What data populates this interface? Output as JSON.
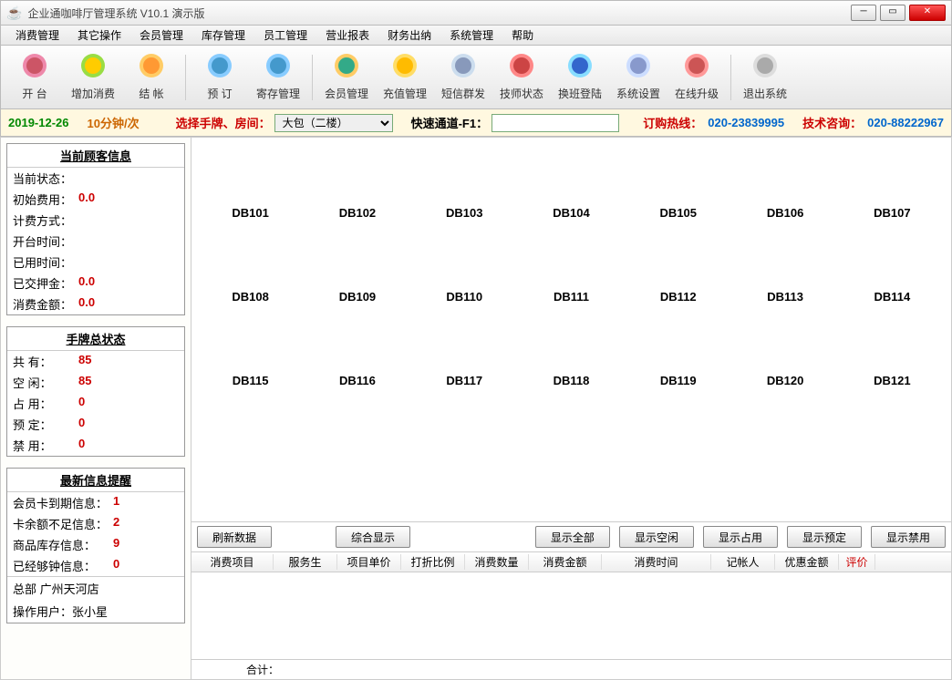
{
  "window": {
    "title": "企业通咖啡厅管理系统 V10.1 演示版"
  },
  "menu": [
    "消费管理",
    "其它操作",
    "会员管理",
    "库存管理",
    "员工管理",
    "营业报表",
    "财务出纳",
    "系统管理",
    "帮助"
  ],
  "toolbar": [
    {
      "id": "kaitai",
      "label": "开 台",
      "color1": "#e8a",
      "color2": "#c56"
    },
    {
      "id": "zengjia",
      "label": "增加消费",
      "color1": "#9d4",
      "color2": "#fc0"
    },
    {
      "id": "jiezhang",
      "label": "结 帐",
      "color1": "#fc6",
      "color2": "#f93"
    },
    {
      "id": "yuding",
      "label": "预 订",
      "color1": "#8cf",
      "color2": "#49c"
    },
    {
      "id": "jicun",
      "label": "寄存管理",
      "color1": "#8cf",
      "color2": "#49c"
    },
    {
      "id": "huiyuan",
      "label": "会员管理",
      "color1": "#fc6",
      "color2": "#3a8"
    },
    {
      "id": "chongzhi",
      "label": "充值管理",
      "color1": "#fd6",
      "color2": "#fb0"
    },
    {
      "id": "duanxin",
      "label": "短信群发",
      "color1": "#cde",
      "color2": "#89b"
    },
    {
      "id": "jishi",
      "label": "技师状态",
      "color1": "#f88",
      "color2": "#c44"
    },
    {
      "id": "huanban",
      "label": "换班登陆",
      "color1": "#8df",
      "color2": "#36c"
    },
    {
      "id": "xitong",
      "label": "系统设置",
      "color1": "#cdf",
      "color2": "#89c"
    },
    {
      "id": "zaixian",
      "label": "在线升级",
      "color1": "#f99",
      "color2": "#c55"
    },
    {
      "id": "tuichu",
      "label": "退出系统",
      "color1": "#ddd",
      "color2": "#aaa"
    }
  ],
  "filter": {
    "date": "2019-12-26",
    "rate": "10分钟/次",
    "select_room_label": "选择手牌、房间：",
    "room_select_value": "大包（二楼）",
    "fast_channel_label": "快速通道-F1：",
    "fast_channel_value": "",
    "hotline_label": "订购热线：",
    "hotline_num": "020-23839995",
    "tech_label": "技术咨询：",
    "tech_num": "020-88222967"
  },
  "guest_panel": {
    "title": "当前顾客信息",
    "rows": [
      {
        "k": "当前状态：",
        "v": ""
      },
      {
        "k": "初始费用：",
        "v": "0.0",
        "red": true
      },
      {
        "k": "计费方式：",
        "v": ""
      },
      {
        "k": "开台时间：",
        "v": ""
      },
      {
        "k": "已用时间：",
        "v": ""
      },
      {
        "k": "已交押金：",
        "v": "0.0",
        "red": true
      },
      {
        "k": "消费金额：",
        "v": "0.0",
        "red": true
      }
    ]
  },
  "status_panel": {
    "title": "手牌总状态",
    "rows": [
      {
        "k": "共    有：",
        "v": "85",
        "red": true
      },
      {
        "k": "空    闲：",
        "v": "85",
        "red": true
      },
      {
        "k": "占    用：",
        "v": "0",
        "red": true
      },
      {
        "k": "预    定：",
        "v": "0",
        "red": true
      },
      {
        "k": "禁    用：",
        "v": "0",
        "red": true
      }
    ]
  },
  "alert_panel": {
    "title": "最新信息提醒",
    "rows": [
      {
        "k": "会员卡到期信息：",
        "v": "1",
        "red": true
      },
      {
        "k": "卡余额不足信息：",
        "v": "2",
        "red": true
      },
      {
        "k": "商品库存信息：",
        "v": "9",
        "red": true
      },
      {
        "k": "已经够钟信息：",
        "v": "0",
        "red": true
      }
    ],
    "store_line1": "总部  广州天河店",
    "store_line2": "操作用户：张小星"
  },
  "rooms": [
    "DB101",
    "DB102",
    "DB103",
    "DB104",
    "DB105",
    "DB106",
    "DB107",
    "DB108",
    "DB109",
    "DB110",
    "DB111",
    "DB112",
    "DB113",
    "DB114",
    "DB115",
    "DB116",
    "DB117",
    "DB118",
    "DB119",
    "DB120",
    "DB121",
    "",
    "",
    "",
    "",
    "",
    "",
    ""
  ],
  "btnrow": {
    "refresh": "刷新数据",
    "comprehensive": "综合显示",
    "all": "显示全部",
    "idle": "显示空闲",
    "used": "显示占用",
    "reserved": "显示预定",
    "disabled": "显示禁用"
  },
  "table_headers": [
    "消费项目",
    "服务生",
    "项目单价",
    "打折比例",
    "消费数量",
    "消费金额",
    "消费时间",
    "记帐人",
    "优惠金额",
    "评价"
  ],
  "table_footer": "合计："
}
